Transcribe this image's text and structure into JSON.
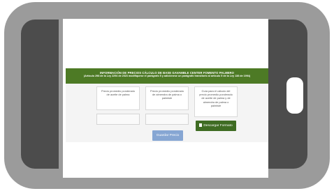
{
  "banner": {
    "title": "INFORMACIÓN DE PRECIOS CÁLCULO DE BASE GAVAMBLE CENTER FOMENTO PALMERO",
    "subtitle": "(Artículo 298 de la Ley 2294 de 2023 modifíquese el parágrafo 5 y adiciónese un parágrafo transitorio al artículo 5 de la Ley 138 de 1994)"
  },
  "cards": [
    {
      "label": "Precio promedio ponderado de aceite de palma"
    },
    {
      "label": "Precio promedio ponderado de almendra de palma o palmiste"
    },
    {
      "label": "Guía para el cálculo del precio promedio ponderado de aceite de palma y de almendra de palma o palmiste"
    }
  ],
  "buttons": {
    "download_label": "Descargar Formato",
    "save_label": "Guardar Precio"
  },
  "colors": {
    "banner": "#4d7a25",
    "download_button": "#3f6c23",
    "save_button": "#86a6d3",
    "phone_frame": "#9b9b9b"
  }
}
